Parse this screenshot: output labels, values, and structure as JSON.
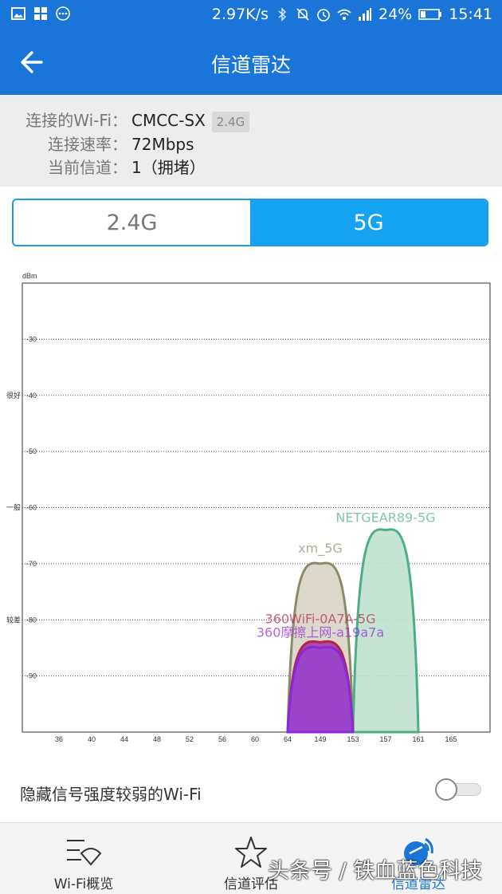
{
  "status_bar": {
    "speed": "2.97K/s",
    "battery": "24%",
    "time": "15:41",
    "left_icons": [
      "image-icon",
      "app-grid-icon",
      "more-icon"
    ],
    "right_icons": [
      "bluetooth-icon",
      "mute-icon",
      "alarm-icon",
      "wifi-icon",
      "signal-icon",
      "battery-icon"
    ]
  },
  "header": {
    "title": "信道雷达",
    "back_icon": "back-arrow-icon",
    "color": "#1976d8"
  },
  "info": {
    "wifi_label": "连接的Wi-Fi：",
    "wifi_value": "CMCC-SX",
    "wifi_band": "2.4G",
    "speed_label": "连接速率：",
    "speed_value": "72Mbps",
    "channel_label": "当前信道：",
    "channel_value": "1（拥堵）"
  },
  "band_toggle": {
    "options": [
      "2.4G",
      "5G"
    ],
    "selected": "5G",
    "accent": "#15a2f0"
  },
  "chart_data": {
    "type": "area",
    "ylabel": "dBm",
    "y_ticks": [
      "-30",
      "-40",
      "-50",
      "-60",
      "-70",
      "-80",
      "-90"
    ],
    "y_quality_labels": [
      {
        "text": "很好",
        "at": -40
      },
      {
        "text": "一般",
        "at": -60
      },
      {
        "text": "较差",
        "at": -80
      }
    ],
    "x_ticks": [
      "36",
      "40",
      "44",
      "48",
      "52",
      "56",
      "60",
      "64",
      "149",
      "153",
      "157",
      "161",
      "165"
    ],
    "y_range": [
      -100,
      -20
    ],
    "grid": "dotted horizontal",
    "series": [
      {
        "name": "xm_5G",
        "center": "149",
        "from": "64",
        "to": "153",
        "peak": -70,
        "stroke": "#8b8a6a",
        "fill": "#d9d4c6"
      },
      {
        "name": "NETGEAR89-5G",
        "center": "157",
        "from": "153",
        "to": "161",
        "peak": -64,
        "stroke": "#4cae87",
        "fill": "#bfe1cf"
      },
      {
        "name": "360WiFi-0A7A-5G",
        "center": "149",
        "from": "64",
        "to": "153",
        "peak": -84,
        "stroke": "#b5234a",
        "fill": "#a03ab0"
      },
      {
        "name": "360摩擦上网-a19a7a",
        "center": "149",
        "from": "64",
        "to": "153",
        "peak": -85,
        "stroke": "#8a2ad6",
        "fill": "#9b44c9"
      }
    ]
  },
  "hide_weak": {
    "label": "隐藏信号强度较弱的Wi-Fi",
    "enabled": false
  },
  "tabs": [
    {
      "label": "Wi-Fi概览",
      "icon": "wifi-overview-icon"
    },
    {
      "label": "信道评估",
      "icon": "star-icon"
    },
    {
      "label": "信道雷达",
      "icon": "radar-icon",
      "active": true
    }
  ],
  "watermark": "头条号 / 铁血蓝色科技"
}
